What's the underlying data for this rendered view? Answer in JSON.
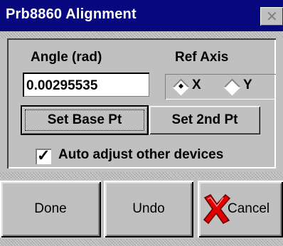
{
  "window": {
    "title": "Prb8860 Alignment",
    "close_glyph": "✕"
  },
  "angle": {
    "label": "Angle (rad)",
    "value": "0.00295535"
  },
  "ref_axis": {
    "label": "Ref Axis",
    "options": [
      {
        "label": "X",
        "selected": true
      },
      {
        "label": "Y",
        "selected": false
      }
    ]
  },
  "buttons": {
    "set_base": "Set Base Pt",
    "set_2nd": "Set 2nd Pt",
    "done": "Done",
    "undo": "Undo",
    "cancel": "Cancel"
  },
  "auto_adjust": {
    "label": "Auto adjust other devices",
    "checked": true,
    "check_glyph": "✓"
  },
  "colors": {
    "titlebar": "#08087e",
    "face": "#c0c0c0",
    "cancel_icon": "#e00000"
  }
}
